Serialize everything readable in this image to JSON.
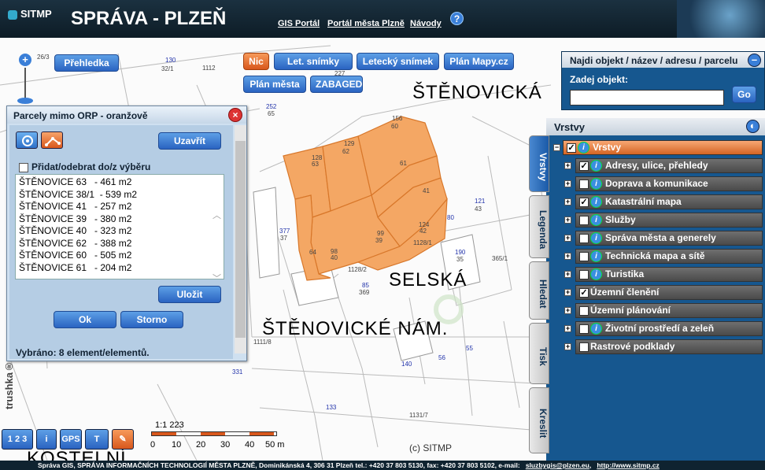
{
  "header": {
    "logo": "SITMP",
    "title": "SPRÁVA - PLZEŇ",
    "links": [
      "GIS Portál",
      "Portál města Plzně",
      "Návody"
    ],
    "help": "?"
  },
  "map_buttons": {
    "prehledka": "Přehledka",
    "nic": "Nic",
    "let_snimky": "Let. snímky ČR",
    "letecky": "Letecký snímek",
    "plan_mapy": "Plán Mapy.cz",
    "plan_mesta": "Plán města",
    "zabaged": "ZABAGED"
  },
  "streets": {
    "s1": "ŠTĚNOVICKÁ",
    "s2": "SELSKÁ",
    "s3": "ŠTĚNOVICKÉ NÁM.",
    "s4": "KOSTELNÍ"
  },
  "parcel_labels": [
    {
      "t": "130"
    },
    {
      "t": "32/1"
    },
    {
      "t": "26/3"
    },
    {
      "t": "1112"
    },
    {
      "t": "227"
    },
    {
      "t": "252"
    },
    {
      "t": "65"
    },
    {
      "t": "156"
    },
    {
      "t": "60"
    },
    {
      "t": "129"
    },
    {
      "t": "62"
    },
    {
      "t": "128"
    },
    {
      "t": "63"
    },
    {
      "t": "61"
    },
    {
      "t": "41"
    },
    {
      "t": "124"
    },
    {
      "t": "42"
    },
    {
      "t": "99"
    },
    {
      "t": "39"
    },
    {
      "t": "98"
    },
    {
      "t": "40"
    },
    {
      "t": "377"
    },
    {
      "t": "37"
    },
    {
      "t": "64"
    },
    {
      "t": "121"
    },
    {
      "t": "43"
    },
    {
      "t": "80"
    },
    {
      "t": "190"
    },
    {
      "t": "35"
    },
    {
      "t": "85"
    },
    {
      "t": "369"
    },
    {
      "t": "140"
    },
    {
      "t": "56"
    },
    {
      "t": "55"
    },
    {
      "t": "133"
    },
    {
      "t": "331"
    },
    {
      "t": "1128/2"
    },
    {
      "t": "1128/1"
    },
    {
      "t": "365/1"
    },
    {
      "t": "1111/8"
    },
    {
      "t": "1131/7"
    }
  ],
  "parcel_panel": {
    "title": "Parcely mimo ORP - oranžově",
    "close": "×",
    "uzavrit": "Uzavřít",
    "checkbox_label": "Přidat/odebrat do/z výběru",
    "items": [
      "ŠTĚNOVICE 63   - 461 m2",
      "ŠTĚNOVICE 38/1  - 539 m2",
      "ŠTĚNOVICE 41   - 257 m2",
      "ŠTĚNOVICE 39   - 380 m2",
      "ŠTĚNOVICE 40   - 323 m2",
      "ŠTĚNOVICE 62   - 388 m2",
      "ŠTĚNOVICE 60   - 505 m2",
      "ŠTĚNOVICE 61   - 204 m2"
    ],
    "ulozit": "Uložit",
    "ok": "Ok",
    "storno": "Storno",
    "status": "Vybráno: 8 element/elementů."
  },
  "find_panel": {
    "title": "Najdi objekt / název / adresu / parcelu",
    "label": "Zadej objekt:",
    "input_value": "",
    "go": "Go",
    "minimize": "–"
  },
  "layers_panel": {
    "title": "Vrstvy",
    "tabs": [
      "Vrstvy",
      "Legenda",
      "Hledat",
      "Tisk",
      "Kreslit"
    ],
    "layers": [
      {
        "label": "Vrstvy",
        "checked": true,
        "info": true
      },
      {
        "label": "Adresy, ulice, přehledy",
        "checked": true,
        "info": true
      },
      {
        "label": "Doprava a komunikace",
        "checked": false,
        "info": true
      },
      {
        "label": "Katastrální mapa",
        "checked": true,
        "info": true
      },
      {
        "label": "Služby",
        "checked": false,
        "info": true
      },
      {
        "label": "Správa města a generely",
        "checked": false,
        "info": true
      },
      {
        "label": "Technická mapa a sítě",
        "checked": false,
        "info": true
      },
      {
        "label": "Turistika",
        "checked": false,
        "info": true
      },
      {
        "label": "Územní členění",
        "checked": true,
        "info": false
      },
      {
        "label": "Územní plánování",
        "checked": false,
        "info": false
      },
      {
        "label": "Životní prostředí a zeleň",
        "checked": false,
        "info": true
      },
      {
        "label": "Rastrové podklady",
        "checked": false,
        "info": false
      }
    ]
  },
  "tools": {
    "t1": "1 2 3",
    "t2": "i",
    "gps": "GPS",
    "t4": "T",
    "t5": "✎"
  },
  "scale": {
    "label": "1:1 223",
    "ticks": [
      "0",
      "10",
      "20",
      "30",
      "40",
      "50 m"
    ]
  },
  "copyright": "(c) SITMP",
  "watermark": "trushka®",
  "footer": {
    "text": "Správa GIS, SPRÁVA INFORMAČNÍCH TECHNOLOGIÍ MĚSTA PLZNĚ, Dominikánská 4, 306 31 Plzeň tel.: +420 37 803 5130, fax: +420 37 803 5102, e-mail:",
    "email": "sluzbygis@plzen.eu",
    "sep": ",",
    "url": "http://www.sitmp.cz"
  },
  "colors": {
    "accent": "#2a63c1",
    "parcel_fill": "#f4a764",
    "header_bg": "#1b3140",
    "panel_blue": "#16578f"
  }
}
